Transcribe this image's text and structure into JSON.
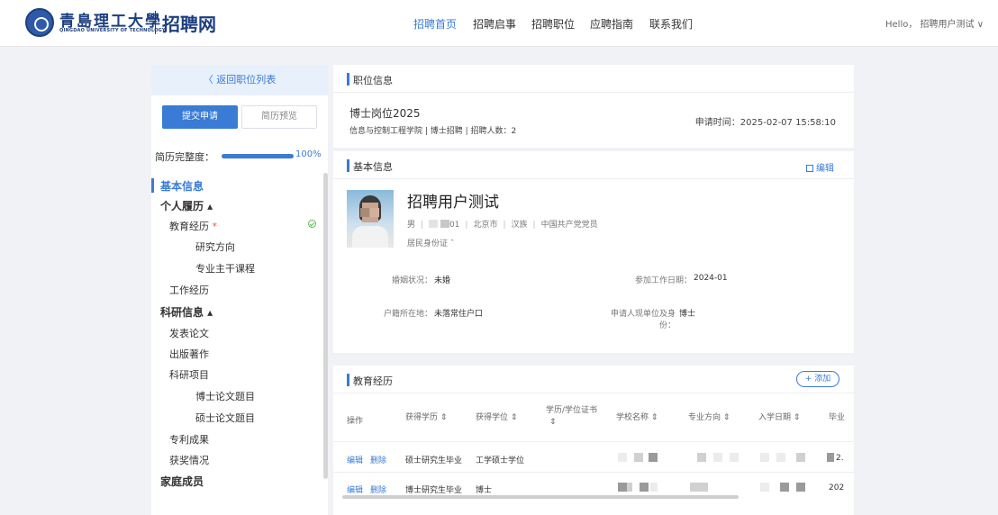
{
  "header": {
    "logo_cn": "青島理工大學",
    "logo_en": "QINGDAO UNIVERSITY OF TECHNOLOGY",
    "site_name": "招聘网",
    "nav": [
      "招聘首页",
      "招聘启事",
      "招聘职位",
      "应聘指南",
      "联系我们"
    ],
    "active_nav": "招聘首页",
    "user_greeting": "Hello， 招聘用户测试 ∨"
  },
  "sidebar": {
    "back_label": "〈 返回职位列表",
    "submit_label": "提交申请",
    "preview_label": "简历预览",
    "completeness_label": "简历完整度：",
    "completeness_value": 1.0,
    "completeness_text": "100%",
    "menu": {
      "basic": "基本信息",
      "personal": "个人履历 ▴",
      "education": "教育经历",
      "education_star": "*",
      "research_direction": "研究方向",
      "major_courses": "专业主干课程",
      "work": "工作经历",
      "research": "科研信息 ▴",
      "papers": "发表论文",
      "books": "出版著作",
      "projects": "科研项目",
      "phd_thesis": "博士论文题目",
      "master_thesis": "硕士论文题目",
      "patents": "专利成果",
      "awards": "获奖情况",
      "family": "家庭成员"
    }
  },
  "job_card": {
    "section_title": "职位信息",
    "position": "博士岗位2025",
    "meta": "信息与控制工程学院 | 博士招聘 | 招聘人数：2",
    "apply_time": "申请时间：2025-02-07 15:58:10"
  },
  "basic_card": {
    "section_title": "基本信息",
    "edit_label": "编辑",
    "name": "招聘用户测试",
    "gender": "男",
    "birth_suffix": "01",
    "city": "北京市",
    "ethnicity": "汉族",
    "party": "中国共产党党员",
    "id_type": "居民身份证 ˆ",
    "marital_label": "婚姻状况：",
    "marital_value": "未婚",
    "work_date_label": "参加工作日期：",
    "work_date_value": "2024-01",
    "hukou_label": "户籍所在地：",
    "hukou_value": "未落常住户口",
    "identity_label": "申请人现单位及身份：",
    "identity_value": "博士"
  },
  "edu_card": {
    "section_title": "教育经历",
    "add_label": "+ 添加",
    "columns": [
      "操作",
      "获得学历 ⇕",
      "获得学位 ⇕",
      "学历/学位证书",
      "⇕",
      "学校名称 ⇕",
      "专业方向 ⇕",
      "入学日期 ⇕",
      "毕业"
    ],
    "rows": [
      {
        "edit": "编辑",
        "delete": "删除",
        "edu": "硕士研究生毕业",
        "degree": "工学硕士学位",
        "tail": "2."
      },
      {
        "edit": "编辑",
        "delete": "删除",
        "edu": "博士研究生毕业",
        "degree": "博士",
        "tail": "202"
      }
    ]
  }
}
